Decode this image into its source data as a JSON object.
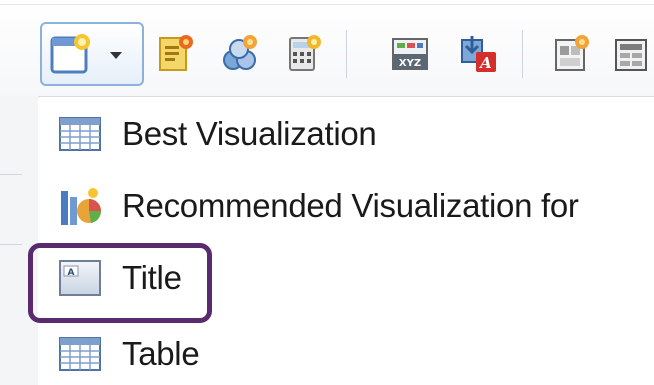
{
  "toolbar": {
    "buttons": [
      {
        "name": "new-view-dropdown-button",
        "icon": "new-view-icon"
      },
      {
        "name": "new-narrative-button",
        "icon": "narrative-icon"
      },
      {
        "name": "new-graph-button",
        "icon": "graph-icon"
      },
      {
        "name": "new-calculator-button",
        "icon": "calculator-icon"
      },
      {
        "name": "xyz-format-button",
        "icon": "xyz-icon"
      },
      {
        "name": "import-export-button",
        "icon": "export-icon"
      },
      {
        "name": "layout-button",
        "icon": "layout-icon"
      },
      {
        "name": "more-button",
        "icon": "grid-icon"
      }
    ]
  },
  "menu": {
    "items": [
      {
        "label": "Best Visualization",
        "icon": "table-grid-icon"
      },
      {
        "label": "Recommended Visualization for",
        "icon": "bar-chart-icon"
      },
      {
        "label": "Title",
        "icon": "title-icon"
      },
      {
        "label": "Table",
        "icon": "table-grid-icon"
      }
    ],
    "highlighted": "Title",
    "highlight_color": "#5a2a6e"
  }
}
